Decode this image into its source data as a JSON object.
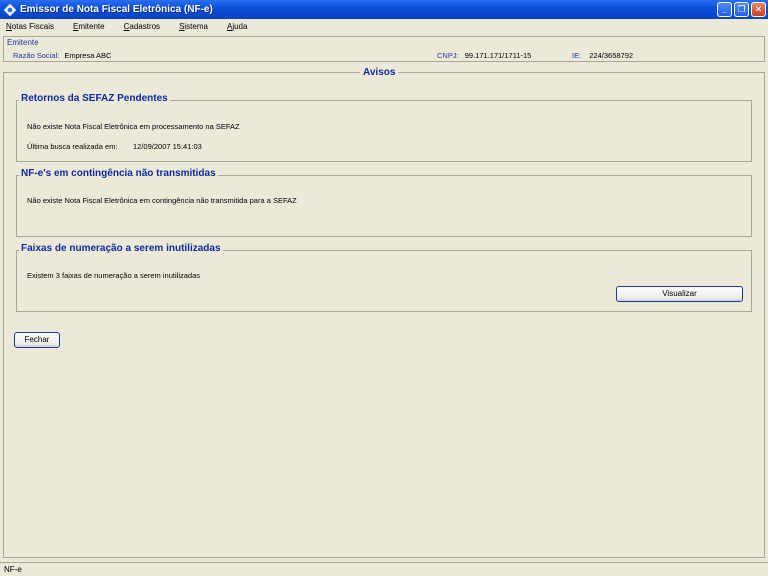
{
  "window": {
    "title": "Emissor de Nota Fiscal Eletrônica (NF-e)",
    "minimize": "_",
    "maximize": "❐",
    "close": "✕"
  },
  "menu": {
    "items": [
      {
        "underline": "N",
        "rest": "otas Fiscais"
      },
      {
        "underline": "E",
        "rest": "mitente"
      },
      {
        "underline": "C",
        "rest": "adastros"
      },
      {
        "underline": "S",
        "rest": "istema"
      },
      {
        "underline": "A",
        "rest": "juda"
      }
    ]
  },
  "emitente": {
    "legend": "Emitente",
    "razao_label": "Razão Social:",
    "razao_value": "Empresa ABC",
    "cnpj_label": "CNPJ:",
    "cnpj_value": "99.171.171/1711-15",
    "ie_label": "IE:",
    "ie_value": "224/3658792"
  },
  "avisos": {
    "title": "Avisos",
    "retornos": {
      "title": "Retornos da SEFAZ Pendentes",
      "line1": "Não existe Nota Fiscal Eletrônica em processamento na SEFAZ",
      "line2_label": "Última busca realizada em:",
      "line2_value": "12/09/2007 15:41:03"
    },
    "contingencia": {
      "title": "NF-e's em contingência não transmitidas",
      "line1": "Não existe Nota Fiscal Eletrônica em contingência não transmitida para a SEFAZ"
    },
    "faixas": {
      "title": "Faixas de numeração a serem inutilizadas",
      "line1": "Existem 3 faixas de numeração a serem inutilizadas",
      "button": "Visualizar"
    }
  },
  "fechar_button": "Fechar",
  "status": "NF-e"
}
